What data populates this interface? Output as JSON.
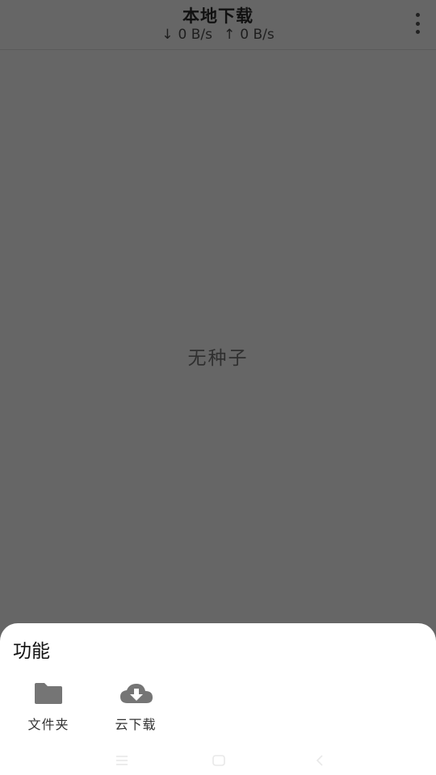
{
  "header": {
    "title": "本地下载",
    "download_arrow": "↓",
    "download_speed": "0 B/s",
    "upload_arrow": "↑",
    "upload_speed": "0 B/s",
    "more_icon": "more-vertical-icon"
  },
  "main": {
    "empty_text": "无种子"
  },
  "sheet": {
    "title": "功能",
    "actions": [
      {
        "label": "文件夹",
        "icon": "folder-icon"
      },
      {
        "label": "云下载",
        "icon": "cloud-download-icon"
      }
    ]
  },
  "navbar": {
    "menu_icon": "menu-icon",
    "home_icon": "home-icon",
    "back_icon": "back-icon"
  },
  "colors": {
    "scrim_background": "#666666",
    "sheet_background": "#ffffff",
    "icon_gray": "#757575",
    "text_dark": "#111111"
  }
}
